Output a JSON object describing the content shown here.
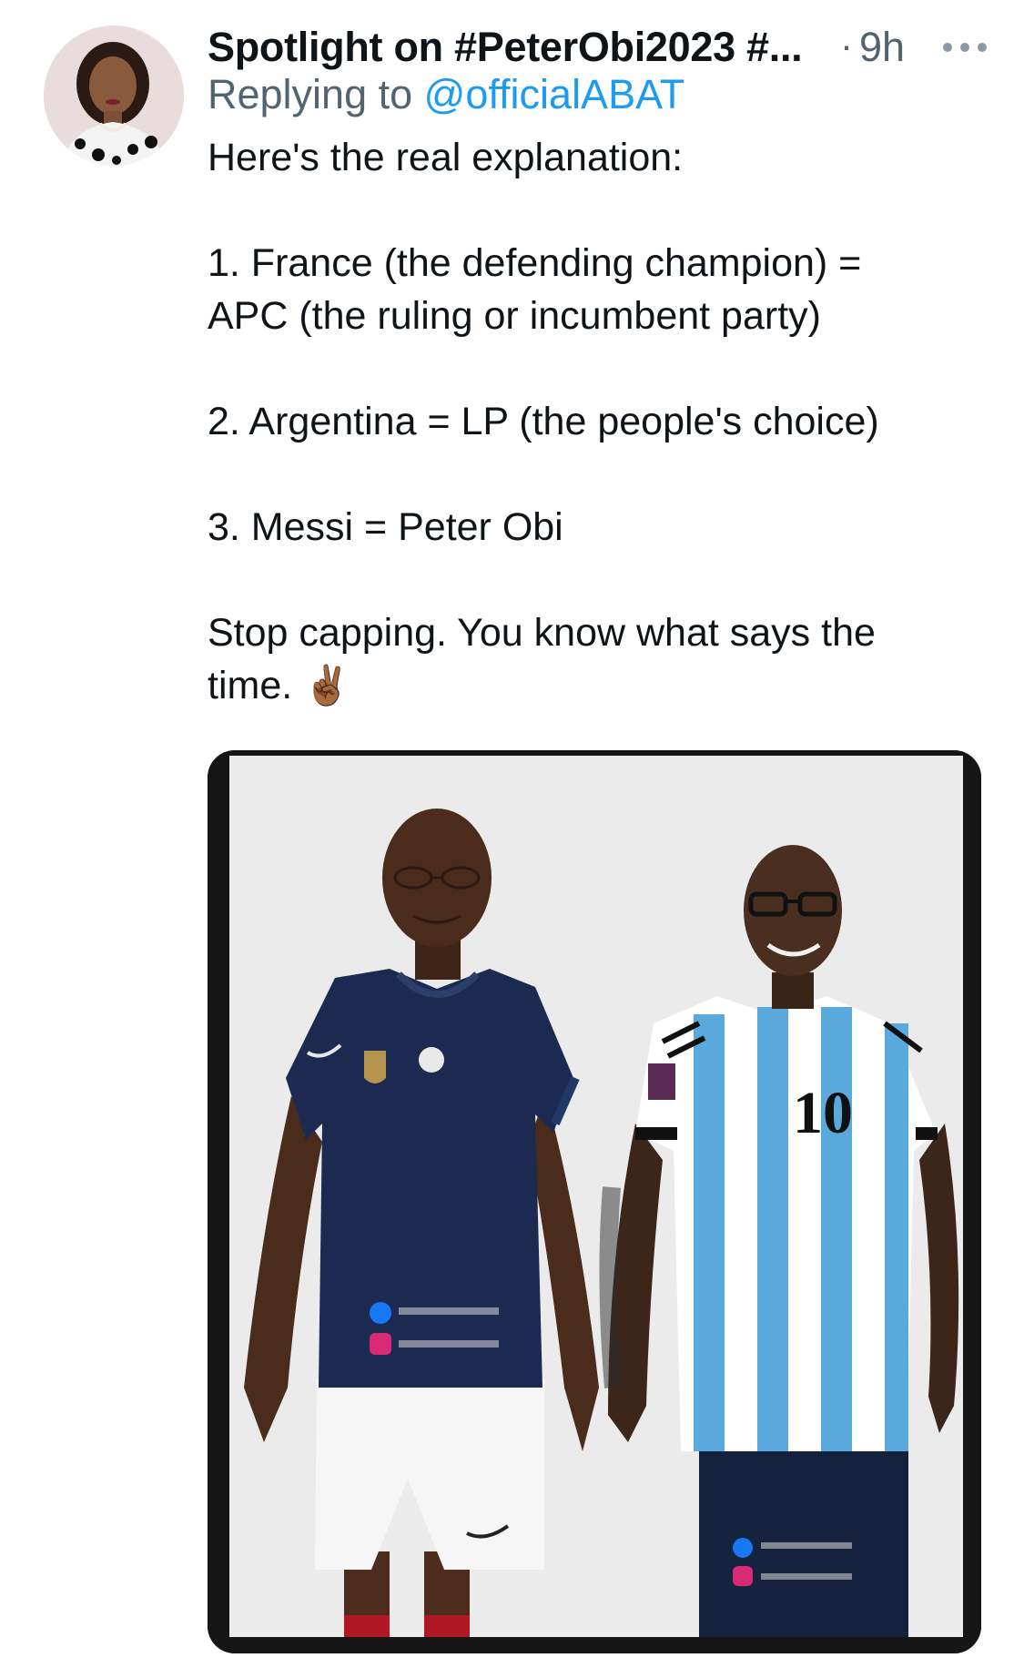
{
  "tweet": {
    "display_name": "Spotlight on #PeterObi2023 #...",
    "separator": "·",
    "timestamp": "9h",
    "replying_to_prefix": "Replying to ",
    "replying_to_handle": "@officialABAT",
    "body": {
      "intro": "Here's the real explanation:",
      "point1_line1": "1. France (the defending champion) =",
      "point1_line2": "APC (the ruling or incumbent party)",
      "point2": "2. Argentina = LP (the people's choice)",
      "point3": "3. Messi = Peter Obi",
      "closing_line1": "Stop capping. You know what says the",
      "closing_line2": "time.",
      "closing_emoji": "✌🏾"
    }
  },
  "media": {
    "jersey_number": "10"
  },
  "colors": {
    "text_primary": "#0f1419",
    "text_secondary": "#536471",
    "link": "#1d9bf0",
    "france_blue": "#1c2a52",
    "argentina_sky": "#5aa9dc"
  },
  "icons": {
    "more": "more-horizontal-icon",
    "avatar": "avatar",
    "facebook": "facebook-icon",
    "instagram": "instagram-icon"
  }
}
